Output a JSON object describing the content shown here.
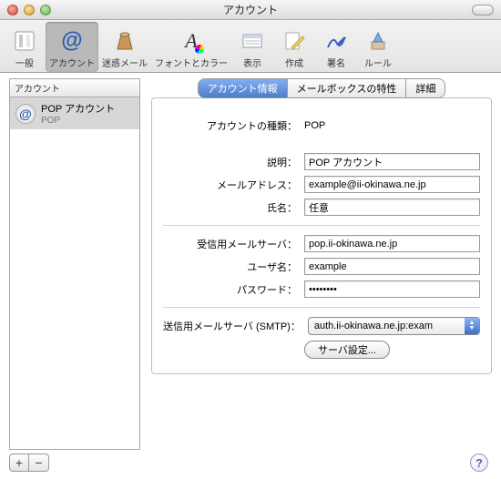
{
  "window": {
    "title": "アカウント"
  },
  "toolbar": [
    {
      "key": "general",
      "label": "一般"
    },
    {
      "key": "accounts",
      "label": "アカウント",
      "selected": true
    },
    {
      "key": "junk",
      "label": "迷惑メール"
    },
    {
      "key": "fonts",
      "label": "フォントとカラー"
    },
    {
      "key": "viewing",
      "label": "表示"
    },
    {
      "key": "compose",
      "label": "作成"
    },
    {
      "key": "sign",
      "label": "署名"
    },
    {
      "key": "rules",
      "label": "ルール"
    }
  ],
  "sidebar": {
    "header": "アカウント",
    "account": {
      "name": "POP アカウント",
      "sub": "POP"
    }
  },
  "tabs": [
    {
      "label": "アカウント情報",
      "active": true
    },
    {
      "label": "メールボックスの特性"
    },
    {
      "label": "詳細"
    }
  ],
  "form": {
    "type_label": "アカウントの種類：",
    "type_value": "POP",
    "desc_label": "説明：",
    "desc_value": "POP アカウント",
    "email_label": "メールアドレス：",
    "email_value": "example@ii-okinawa.ne.jp",
    "name_label": "氏名：",
    "name_value": "任意",
    "pop_label": "受信用メールサーバ：",
    "pop_value": "pop.ii-okinawa.ne.jp",
    "user_label": "ユーザ名：",
    "user_value": "example",
    "pass_label": "パスワード：",
    "pass_value": "••••••••",
    "smtp_label": "送信用メールサーバ (SMTP)：",
    "smtp_value": "auth.ii-okinawa.ne.jp:exam",
    "server_settings_btn": "サーバ設定..."
  },
  "buttons": {
    "add": "+",
    "remove": "−",
    "help": "?"
  }
}
